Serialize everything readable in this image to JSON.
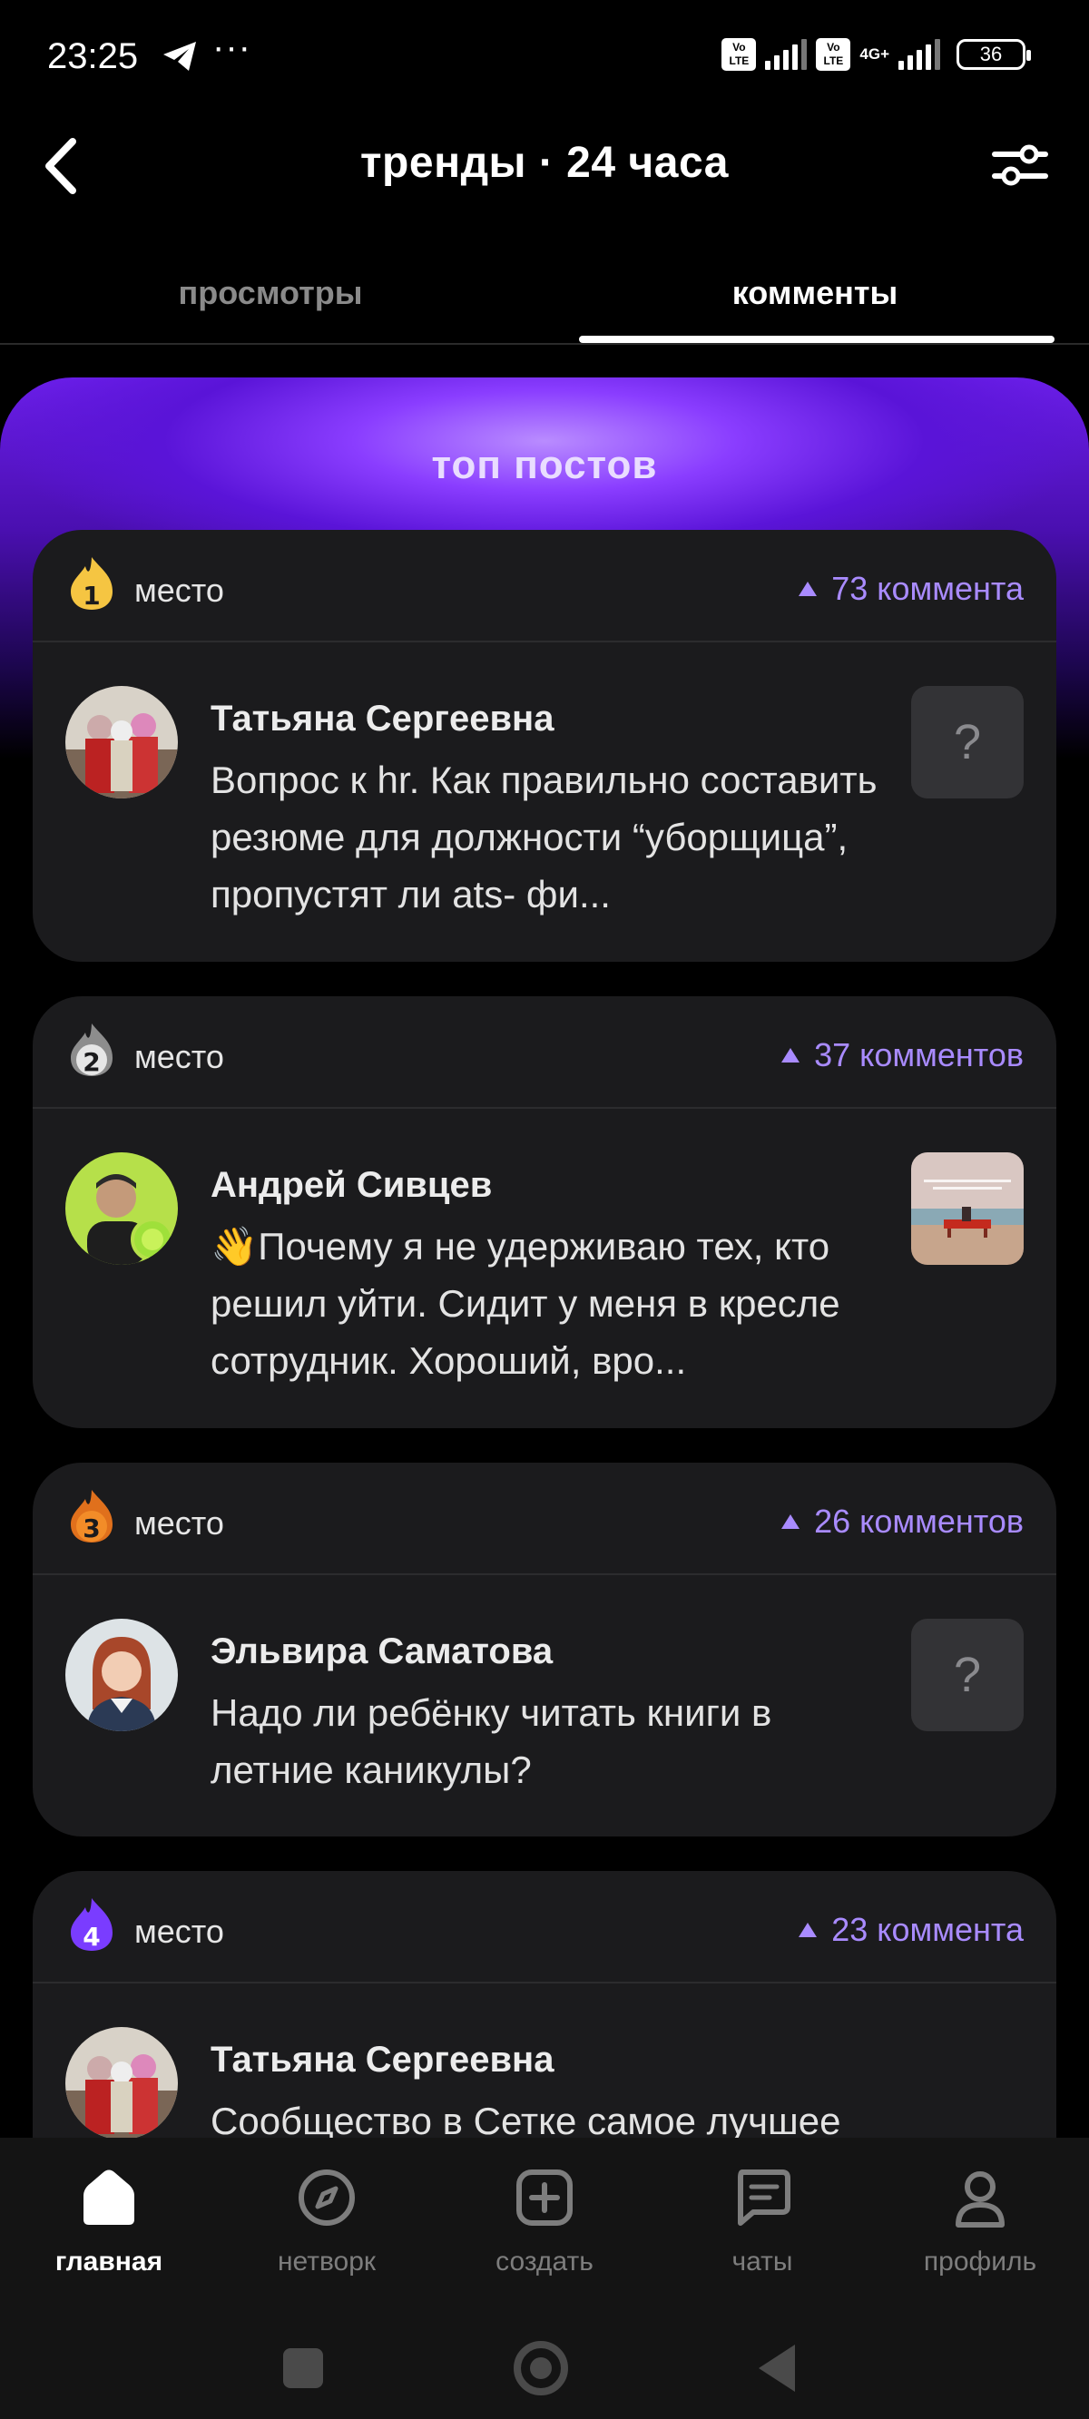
{
  "status_bar": {
    "time": "23:25",
    "dots": "···",
    "volte1": "Vo LTE",
    "volte2": "Vo LTE",
    "network": "4G+",
    "battery": "36"
  },
  "header": {
    "title": "тренды · 24 часа",
    "back_icon": "chevron-left-icon",
    "filter_icon": "sliders-icon"
  },
  "tabs": [
    {
      "label": "просмотры",
      "active": false
    },
    {
      "label": "комменты",
      "active": true
    }
  ],
  "banner": {
    "title": "топ постов"
  },
  "posts": [
    {
      "rank": "1",
      "place_label": "место",
      "comments": "73 коммента",
      "author": "Татьяна Сергеевна",
      "text": "Вопрос к hr. Как правильно составить резюме для должности “уборщица”, пропустят ли ats- фи...",
      "thumb": "?",
      "rank_color": "#f5c542"
    },
    {
      "rank": "2",
      "place_label": "место",
      "comments": "37 комментов",
      "author": "Андрей Сивцев",
      "text": "👋Почему я не удерживаю тех, кто решил уйти. Сидит у меня в кресле сотрудник. Хороший, вро...",
      "thumb": "",
      "rank_color": "#bdbdbd"
    },
    {
      "rank": "3",
      "place_label": "место",
      "comments": "26 комментов",
      "author": "Эльвира Саматова",
      "text": "Надо ли ребёнку читать книги в летние каникулы?",
      "thumb": "?",
      "rank_color": "#f28c28"
    },
    {
      "rank": "4",
      "place_label": "место",
      "comments": "23 коммента",
      "author": "Татьяна Сергеевна",
      "text": "Сообщество в Сетке самое лучшее",
      "thumb": "",
      "rank_color": "#7a3cff"
    }
  ],
  "bottom_nav": [
    {
      "label": "главная",
      "icon": "home-icon",
      "active": true
    },
    {
      "label": "нетворк",
      "icon": "compass-icon",
      "active": false
    },
    {
      "label": "создать",
      "icon": "plus-square-icon",
      "active": false
    },
    {
      "label": "чаты",
      "icon": "chat-icon",
      "active": false
    },
    {
      "label": "профиль",
      "icon": "user-icon",
      "active": false
    }
  ],
  "colors": {
    "accent": "#a98bff",
    "card_bg": "#1b1b1d",
    "banner": "#6a1ee8"
  }
}
